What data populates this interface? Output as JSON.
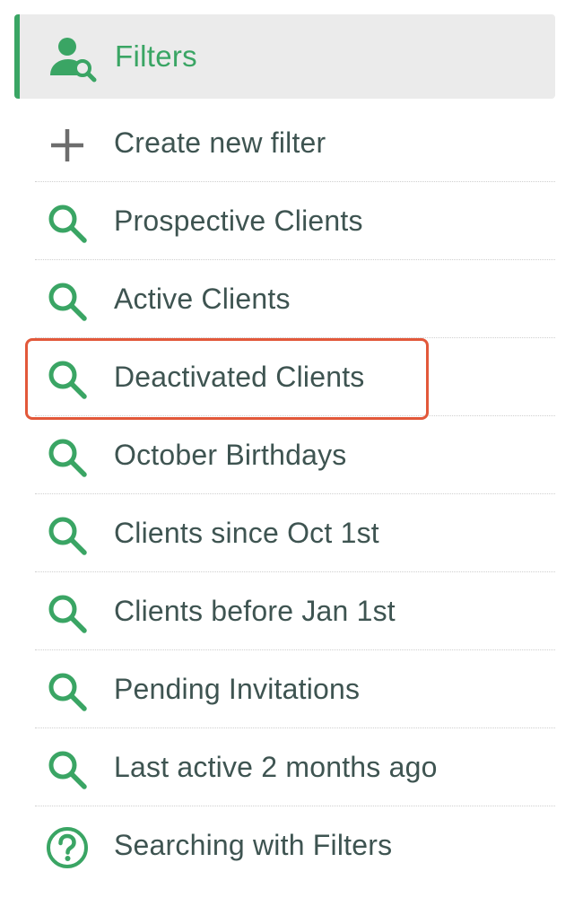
{
  "header": {
    "title": "Filters",
    "icon": "user-search-icon",
    "accent_color": "#3aa564"
  },
  "menu": {
    "items": [
      {
        "label": "Create new filter",
        "icon": "plus-icon"
      },
      {
        "label": "Prospective Clients",
        "icon": "search-icon"
      },
      {
        "label": "Active Clients",
        "icon": "search-icon"
      },
      {
        "label": "Deactivated Clients",
        "icon": "search-icon",
        "highlighted": true
      },
      {
        "label": "October Birthdays",
        "icon": "search-icon"
      },
      {
        "label": "Clients since Oct 1st",
        "icon": "search-icon"
      },
      {
        "label": "Clients before Jan 1st",
        "icon": "search-icon"
      },
      {
        "label": "Pending Invitations",
        "icon": "search-icon"
      },
      {
        "label": "Last active 2 months ago",
        "icon": "search-icon"
      },
      {
        "label": "Searching with Filters",
        "icon": "help-circle-icon"
      }
    ]
  },
  "colors": {
    "text": "#3e5451",
    "icon_green": "#3aa564",
    "icon_grey": "#6d6d6d",
    "highlight_border": "#e2583a",
    "header_bg": "#ebebeb"
  }
}
